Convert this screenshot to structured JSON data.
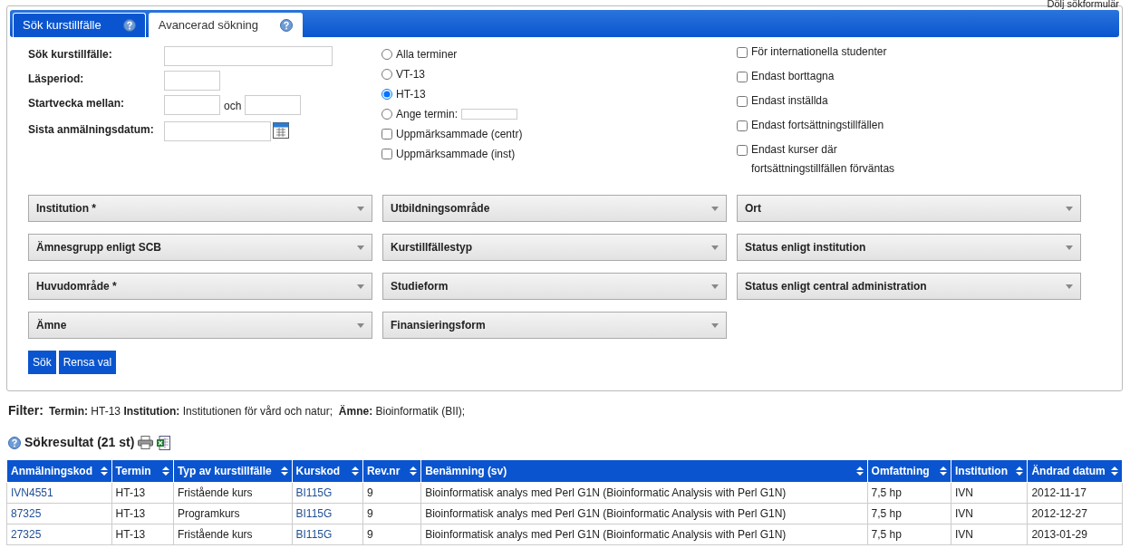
{
  "top_link": "Dölj sökformulär",
  "tabs": [
    {
      "label": "Sök kurstillfälle",
      "selected": false
    },
    {
      "label": "Avancerad sökning",
      "selected": true
    }
  ],
  "fields": [
    {
      "label": "Sök kurstillfälle:",
      "kind": "wide"
    },
    {
      "label": "Läsperiod:",
      "kind": "short"
    },
    {
      "label": "Startvecka mellan:",
      "kind": "range",
      "joiner": "och"
    },
    {
      "label": "Sista anmälningsdatum:",
      "kind": "date"
    }
  ],
  "terms": [
    {
      "label": "Alla terminer",
      "selected": false,
      "kind": "plain"
    },
    {
      "label": "VT-13",
      "selected": false,
      "kind": "plain"
    },
    {
      "label": "HT-13",
      "selected": true,
      "kind": "plain"
    },
    {
      "label": "Ange termin:",
      "selected": false,
      "kind": "field"
    }
  ],
  "mark_options": [
    {
      "label": "Uppmärksammade (centr)",
      "checked": false
    },
    {
      "label": "Uppmärksammade (inst)",
      "checked": false
    }
  ],
  "flag_options": [
    {
      "label": "För internationella studenter",
      "checked": false
    },
    {
      "label": "Endast borttagna",
      "checked": false
    },
    {
      "label": "Endast inställda",
      "checked": false
    },
    {
      "label": "Endast fortsättningstillfällen",
      "checked": false
    },
    {
      "label": "Endast kurser där fortsättningstillfällen förväntas",
      "checked": false
    }
  ],
  "dropdowns": [
    {
      "label": "Institution *"
    },
    {
      "label": "Utbildningsområde"
    },
    {
      "label": "Ort"
    },
    {
      "label": "Ämnesgrupp enligt SCB"
    },
    {
      "label": "Kurstillfällestyp"
    },
    {
      "label": "Status enligt institution"
    },
    {
      "label": "Huvudområde *"
    },
    {
      "label": "Studieform"
    },
    {
      "label": "Status enligt central administration"
    },
    {
      "label": "Ämne"
    },
    {
      "label": "Finansieringsform"
    }
  ],
  "buttons": [
    "Sök",
    "Rensa val"
  ],
  "filter": {
    "label": "Filter:",
    "text": "**Termin:** HT-13 **Institution:** Institutionen för vård och natur;  **Ämne:** Bioinformatik (BII);"
  },
  "results": {
    "title": "Sökresultat (21 st)",
    "columns": [
      {
        "label": "Anmälningskod",
        "link": true
      },
      {
        "label": "Termin",
        "link": false
      },
      {
        "label": "Typ av kurstillfälle",
        "link": false
      },
      {
        "label": "Kurskod",
        "link": true
      },
      {
        "label": "Rev.nr",
        "link": false
      },
      {
        "label": "Benämning (sv)",
        "link": false
      },
      {
        "label": "Omfattning",
        "link": false
      },
      {
        "label": "Institution",
        "link": false
      },
      {
        "label": "Ändrad datum",
        "link": false
      }
    ],
    "rows": [
      [
        "IVN4551",
        "HT-13",
        "Fristående kurs",
        "BI115G",
        "9",
        "Bioinformatisk analys med Perl G1N (Bioinformatic Analysis with Perl G1N)",
        "7,5 hp",
        "IVN",
        "2012-11-17"
      ],
      [
        "87325",
        "HT-13",
        "Programkurs",
        "BI115G",
        "9",
        "Bioinformatisk analys med Perl G1N (Bioinformatic Analysis with Perl G1N)",
        "7,5 hp",
        "IVN",
        "2012-12-27"
      ],
      [
        "27325",
        "HT-13",
        "Fristående kurs",
        "BI115G",
        "9",
        "Bioinformatisk analys med Perl G1N (Bioinformatic Analysis with Perl G1N)",
        "7,5 hp",
        "IVN",
        "2013-01-29"
      ]
    ]
  }
}
